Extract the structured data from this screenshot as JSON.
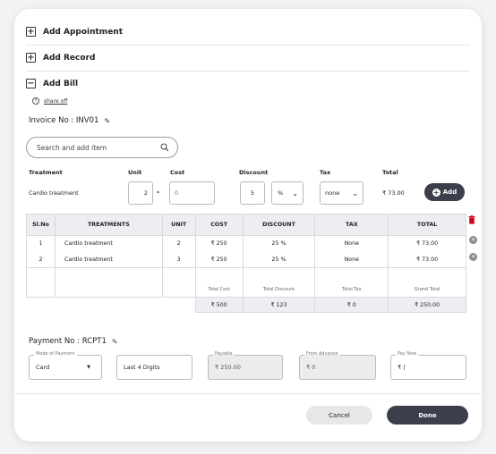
{
  "sections": [
    {
      "icon": "plus-box-icon",
      "label": "Add Appointment"
    },
    {
      "icon": "plus-box-icon",
      "label": "Add Record"
    },
    {
      "icon": "minus-box-icon",
      "label": "Add Bill"
    }
  ],
  "share": {
    "label": "share off"
  },
  "invoice": {
    "label": "Invoice No : INV01"
  },
  "search": {
    "placeholder": "Search and add item"
  },
  "entry": {
    "headers": {
      "treatment": "Treatment",
      "unit": "Unit",
      "cost": "Cost",
      "discount": "Discount",
      "tax": "Tax",
      "total": "Total"
    },
    "treatment": "Cardio treatment",
    "unit": "2",
    "multiply": "*",
    "cost": "0",
    "discount": "5",
    "discount_type": "%",
    "tax": "none",
    "total": "₹ 73.00",
    "add_label": "Add"
  },
  "table": {
    "columns": [
      "Sl.No",
      "TREATMENTS",
      "UNIT",
      "COST",
      "DISCOUNT",
      "TAX",
      "TOTAL"
    ],
    "rows": [
      {
        "sl": "1",
        "treatment": "Cardio treatment",
        "unit": "2",
        "cost": "₹ 250",
        "discount": "25  %",
        "tax": "None",
        "total": "₹ 73.00"
      },
      {
        "sl": "2",
        "treatment": "Cardio treatment",
        "unit": "3",
        "cost": "₹ 250",
        "discount": "25  %",
        "tax": "None",
        "total": "₹ 73.00"
      }
    ],
    "totals_labels": {
      "cost": "Total Cost",
      "discount": "Total Discount",
      "tax": "Total Tax",
      "grand": "Grand Total"
    },
    "totals": {
      "cost": "₹ 500",
      "discount": "₹ 123",
      "tax": "₹ 0",
      "grand": "₹ 250.00"
    }
  },
  "payment": {
    "label": "Payment No : RCPT1",
    "mode_legend": "Mode of Payment",
    "mode_value": "Card",
    "last4_placeholder": "Last 4 Digits",
    "payable_legend": "Payable",
    "payable_value": "₹ 250.00",
    "advance_legend": "From Advance",
    "advance_value": "₹ 0",
    "paynow_legend": "Pay Now",
    "paynow_value": "₹ |"
  },
  "actions": {
    "cancel": "Cancel",
    "done": "Done"
  },
  "colors": {
    "primary_dark": "#3a3f4b",
    "delete_red": "#d0021b"
  }
}
